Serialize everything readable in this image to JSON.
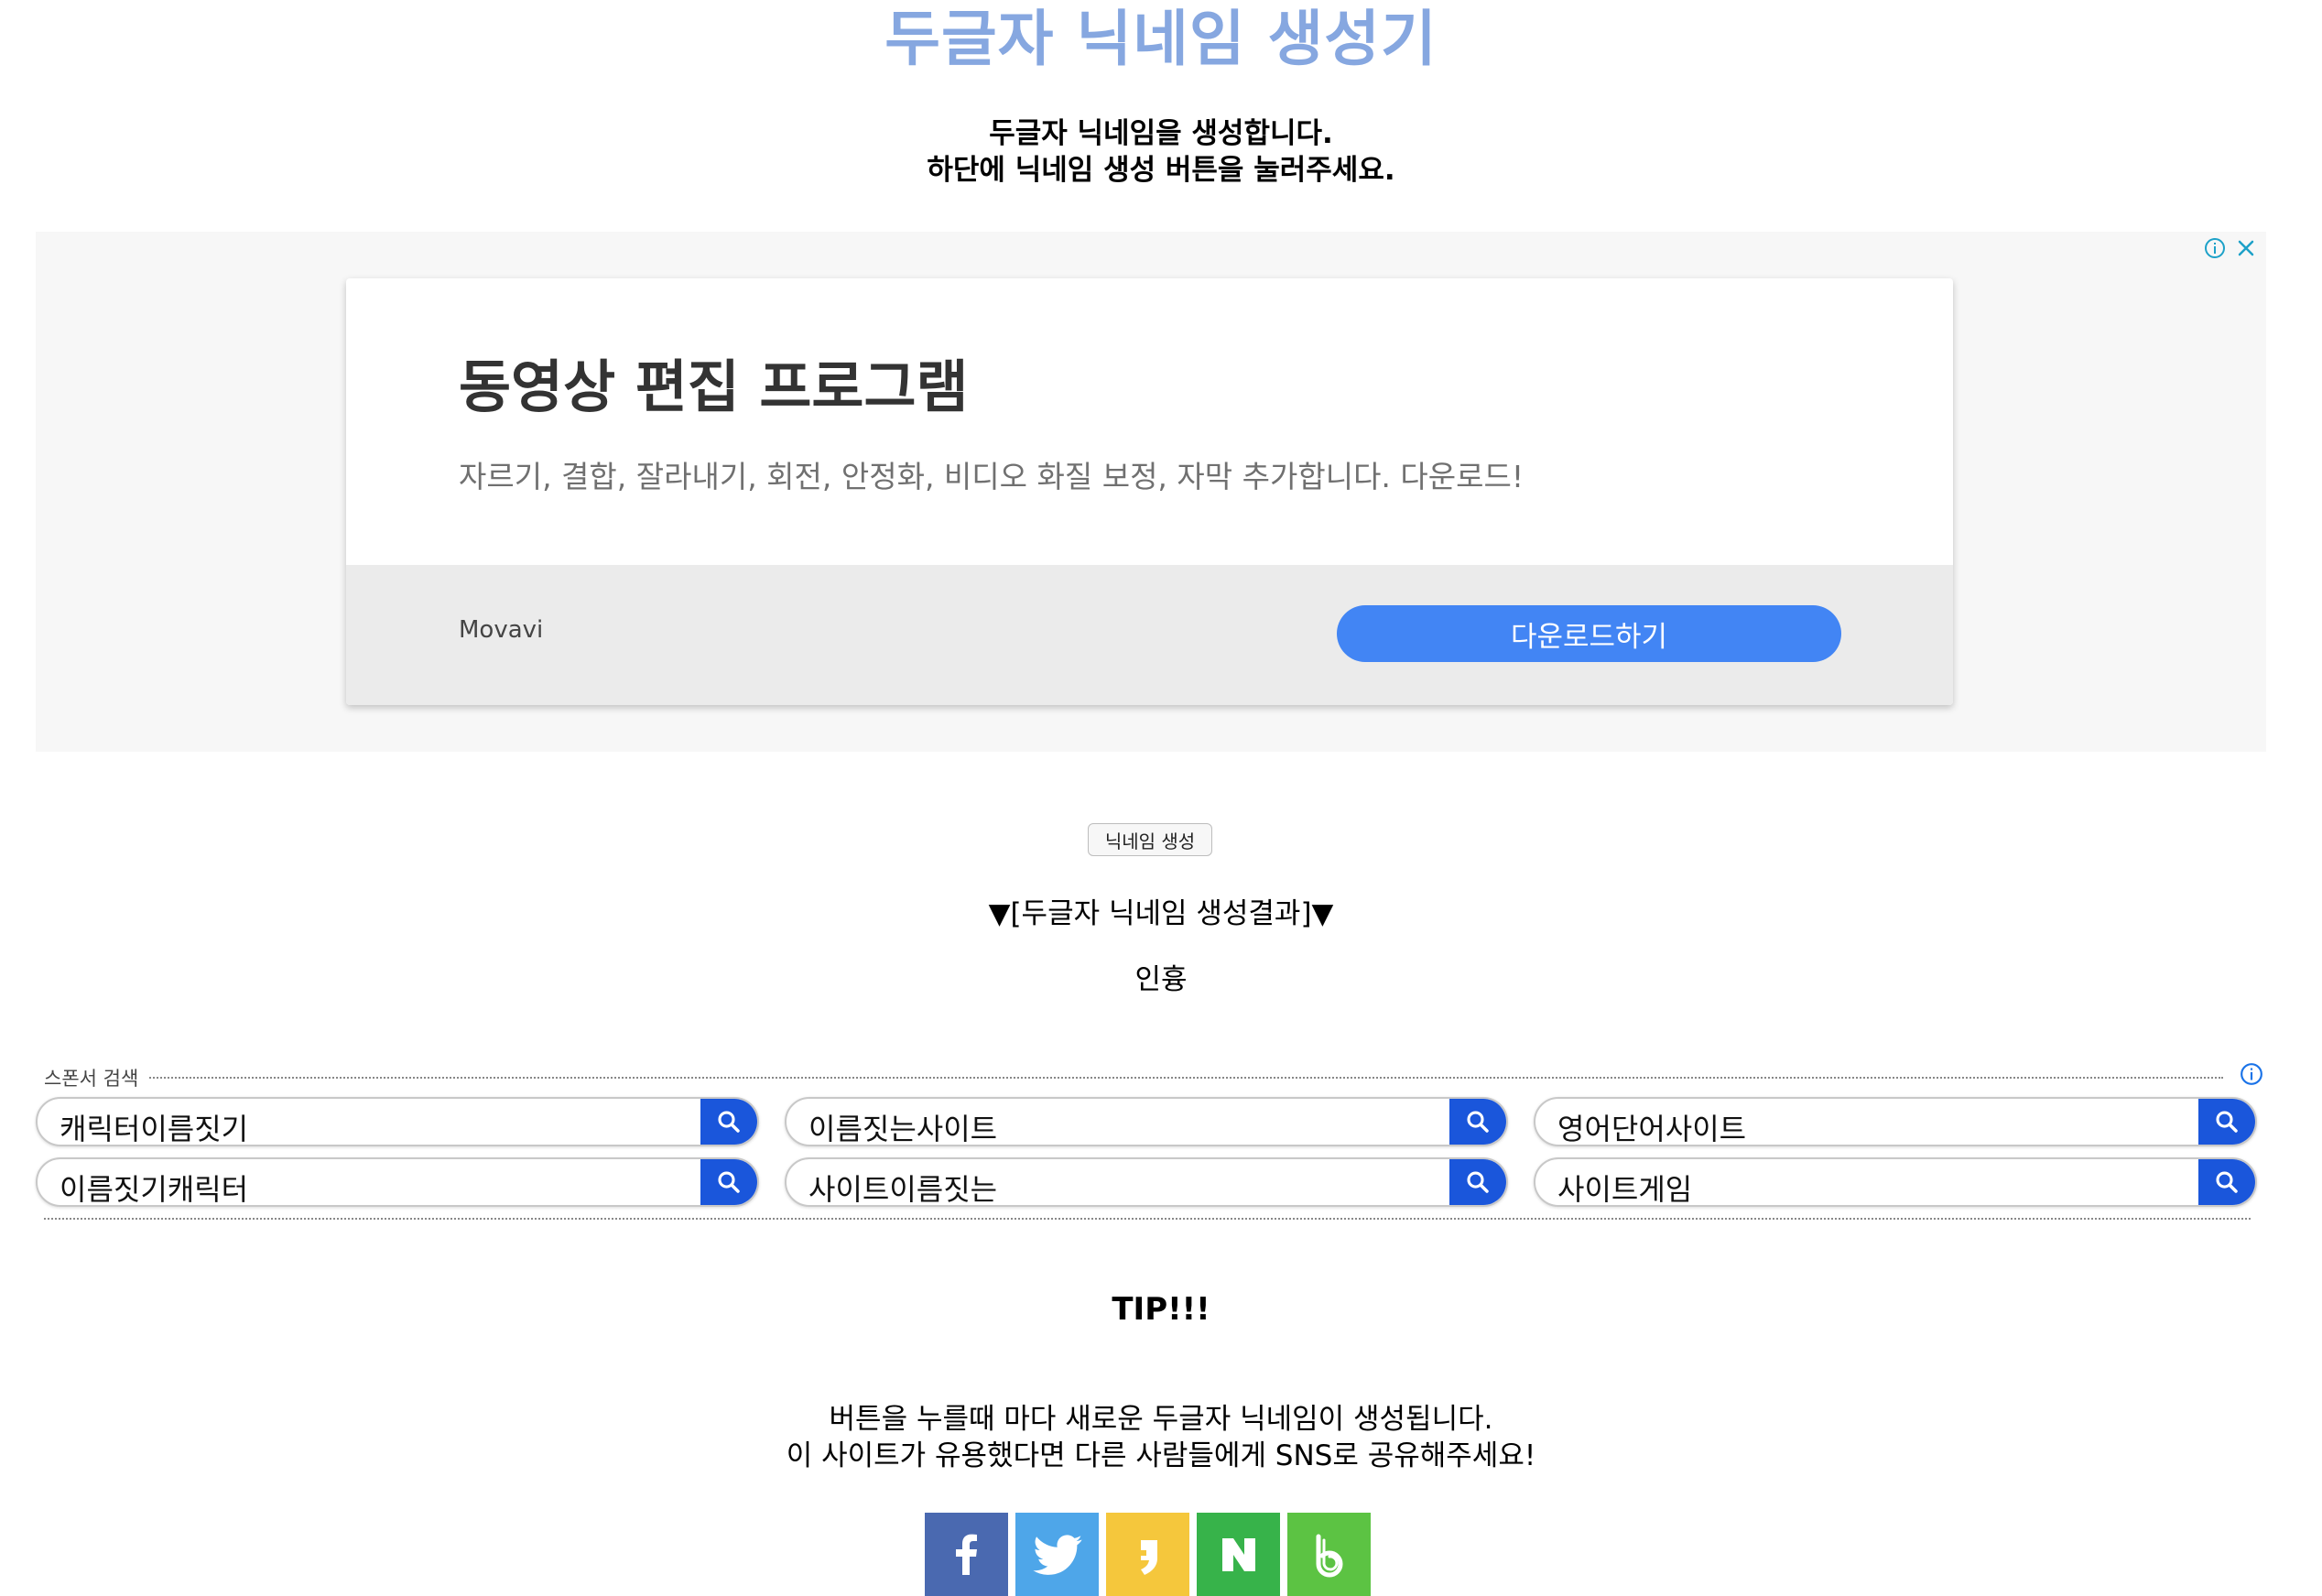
{
  "header": {
    "title": "두글자 닉네임 생성기",
    "intro_line1": "두글자 닉네임을 생성합니다.",
    "intro_line2": "하단에 닉네임 생성 버튼을 눌러주세요."
  },
  "ad": {
    "headline": "동영상 편집 프로그램",
    "description": "자르기, 결합, 잘라내기, 회전, 안정화, 비디오 화질 보정, 자막 추가합니다. 다운로드!",
    "brand": "Movavi",
    "cta_label": "다운로드하기",
    "accent_color": "#4285f4"
  },
  "generator": {
    "button_label": "닉네임 생성",
    "result_heading": "▼[두글자 닉네임 생성결과]▼",
    "result_value": "인흉"
  },
  "sponsor": {
    "label": "스폰서 검색",
    "items": [
      {
        "term": "캐릭터이름짓기"
      },
      {
        "term": "이름짓는사이트"
      },
      {
        "term": "영어단어사이트"
      },
      {
        "term": "이름짓기캐릭터"
      },
      {
        "term": "사이트이름짓는"
      },
      {
        "term": "사이트게임"
      }
    ],
    "button_color": "#1a56db"
  },
  "tip": {
    "title": "TIP!!!",
    "line1": "버튼을 누를때 마다 새로운 두글자 닉네임이 생성됩니다.",
    "line2": "이 사이트가 유용했다면 다른 사람들에게 SNS로 공유해주세요!"
  },
  "share": [
    {
      "icon": "facebook-icon",
      "color": "#4a69b0"
    },
    {
      "icon": "twitter-icon",
      "color": "#4ea6e9"
    },
    {
      "icon": "kakaostory-icon",
      "color": "#f5c73c"
    },
    {
      "icon": "naver-icon",
      "color": "#37b34a"
    },
    {
      "icon": "band-icon",
      "color": "#5cc343"
    }
  ]
}
